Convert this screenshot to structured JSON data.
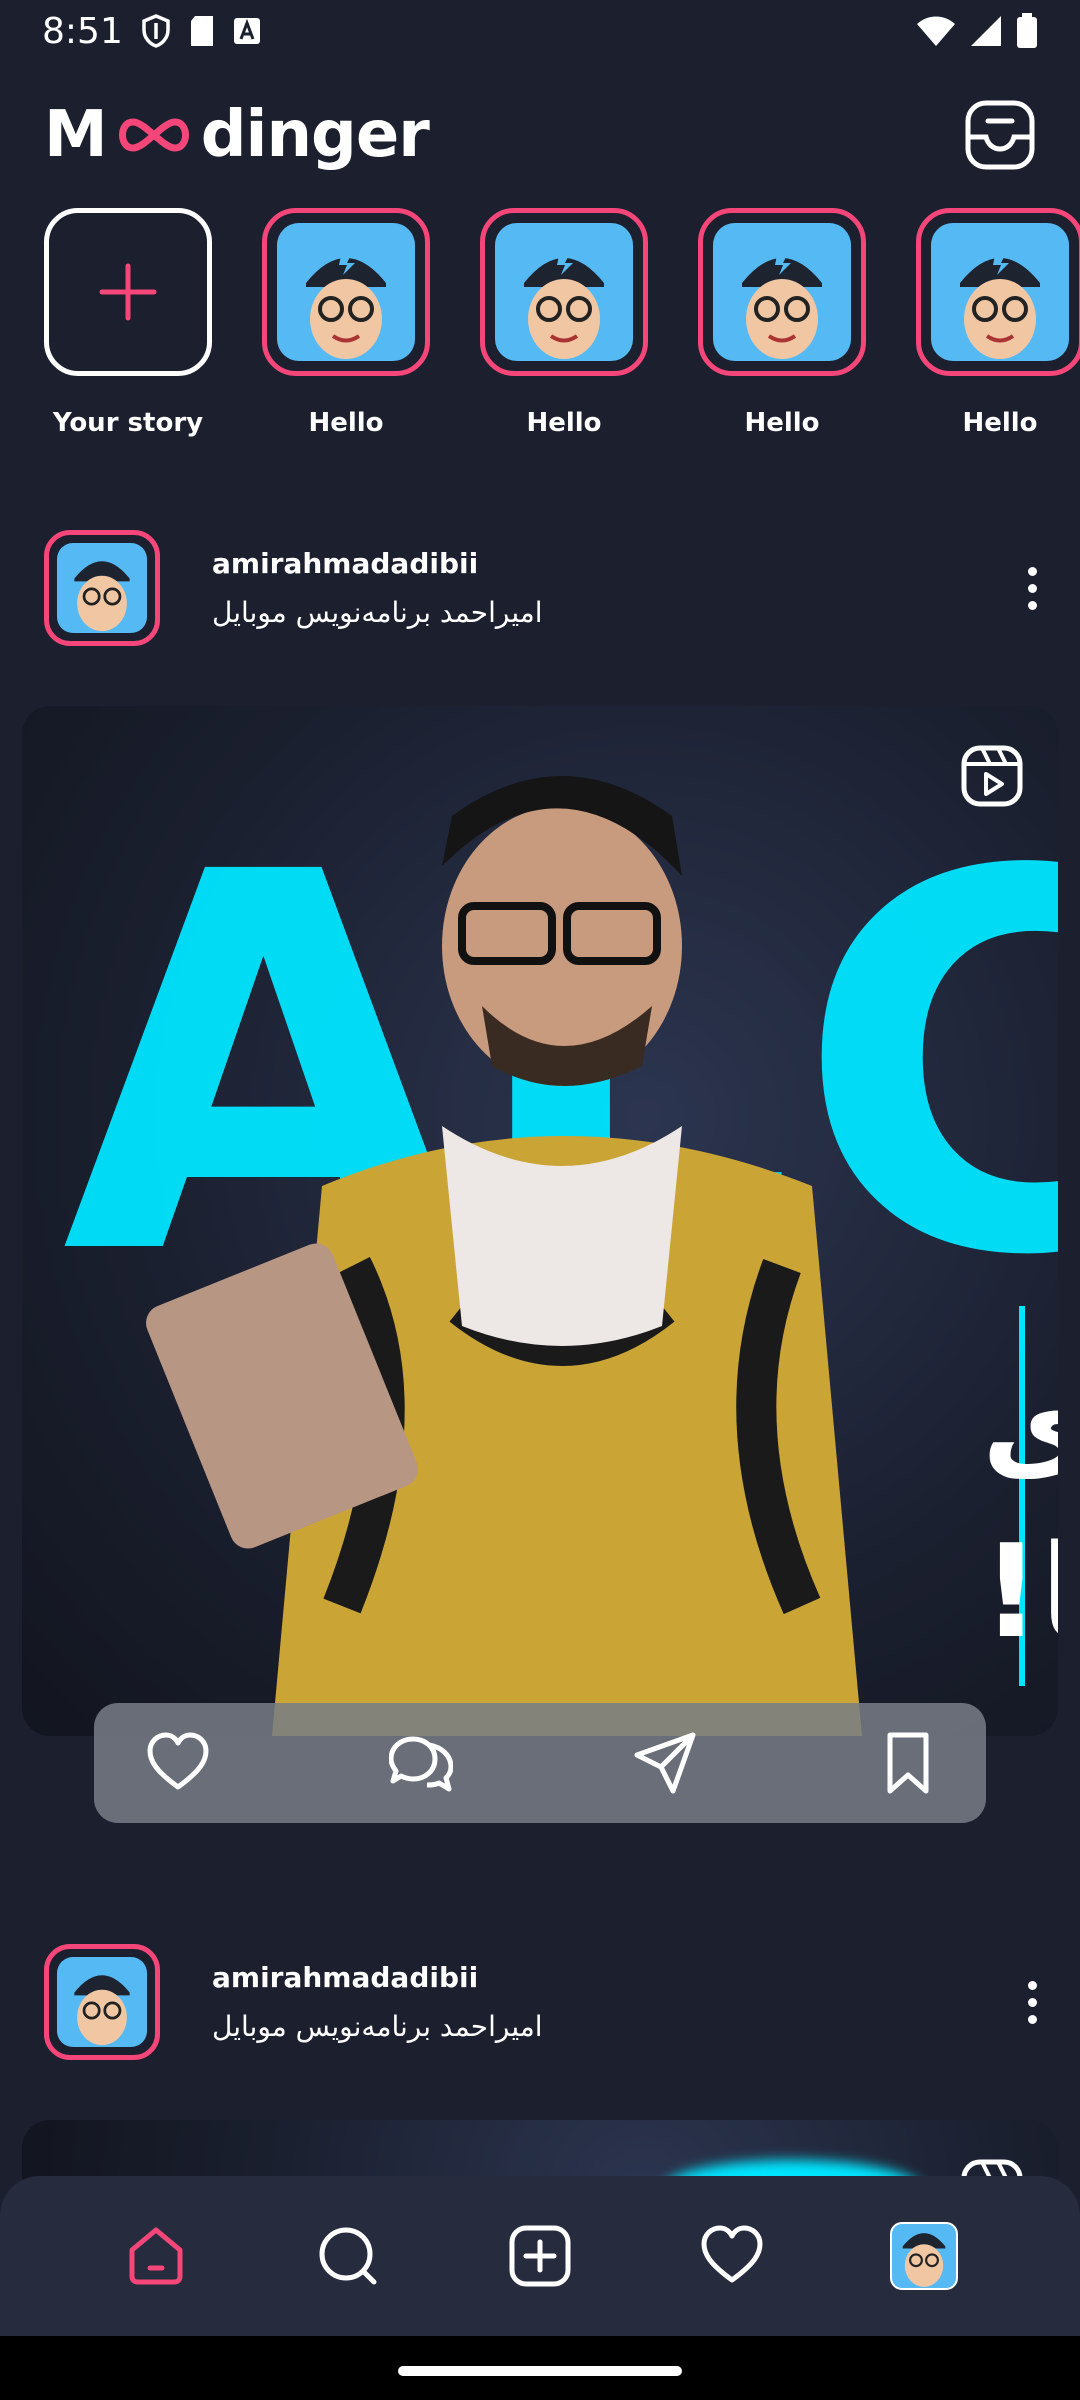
{
  "status_bar": {
    "time": "8:51"
  },
  "header": {
    "logo_start": "M",
    "logo_end": "dinger"
  },
  "stories": [
    {
      "label": "Your story",
      "type": "add"
    },
    {
      "label": "Hello",
      "type": "user"
    },
    {
      "label": "Hello",
      "type": "user"
    },
    {
      "label": "Hello",
      "type": "user"
    },
    {
      "label": "Hello",
      "type": "user"
    }
  ],
  "posts": [
    {
      "username": "amirahmadadibii",
      "subtitle": "امیراحمد برنامه‌نویس موبایل",
      "image_big_text": "ALC",
      "image_text_line1": "انگلیسی برای",
      "image_text_line2": "برنامه نویس ها!"
    },
    {
      "username": "amirahmadadibii",
      "subtitle": "امیراحمد برنامه‌نویس موبایل"
    }
  ],
  "colors": {
    "background": "#1c1f2e",
    "accent": "#f5467a",
    "avatar_bg": "#55b9f3",
    "nav_bg": "#272b3e"
  },
  "icons": {
    "header": "inbox-icon",
    "post_actions": [
      "heart-icon",
      "comment-icon",
      "send-icon",
      "bookmark-icon"
    ],
    "nav": [
      "home-icon",
      "search-icon",
      "add-icon",
      "heart-icon",
      "profile-avatar"
    ]
  }
}
